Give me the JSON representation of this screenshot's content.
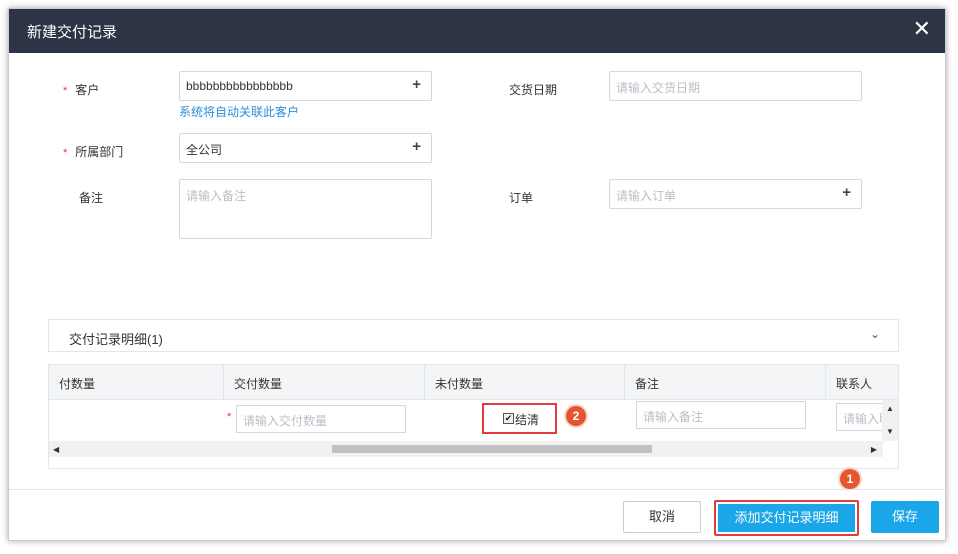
{
  "dialog": {
    "title": "新建交付记录",
    "close_icon": "✕"
  },
  "form": {
    "customer": {
      "required_mark": "*",
      "label": "客户",
      "value": "bbbbbbbbbbbbbbbb",
      "hint": "系统将自动关联此客户"
    },
    "department": {
      "required_mark": "*",
      "label": "所属部门",
      "value": "全公司"
    },
    "remark": {
      "label": "备注",
      "placeholder": "请输入备注"
    },
    "delivery_date": {
      "label": "交货日期",
      "placeholder": "请输入交货日期"
    },
    "order": {
      "label": "订单",
      "placeholder": "请输入订单"
    },
    "plus_icon": "+"
  },
  "detail": {
    "section_title": "交付记录明细(1)",
    "collapse_icon": "⌄",
    "columns": [
      "付数量",
      "交付数量",
      "未付数量",
      "备注",
      "联系人"
    ],
    "row": {
      "required_mark": "*",
      "delivered_qty_placeholder": "请输入交付数量",
      "settled_label": "结清",
      "settled_checked": true,
      "remark_placeholder": "请输入备注",
      "contact_placeholder": "请输入联"
    }
  },
  "annotations": {
    "badge_1": "1",
    "badge_2": "2"
  },
  "footer": {
    "cancel_label": "取消",
    "add_detail_label": "添加交付记录明细",
    "save_label": "保存"
  },
  "colors": {
    "titlebar": "#2d3446",
    "primary": "#1aa6e8",
    "highlight": "#e23b3b",
    "badge": "#e4572e",
    "link": "#2b8fd9"
  }
}
